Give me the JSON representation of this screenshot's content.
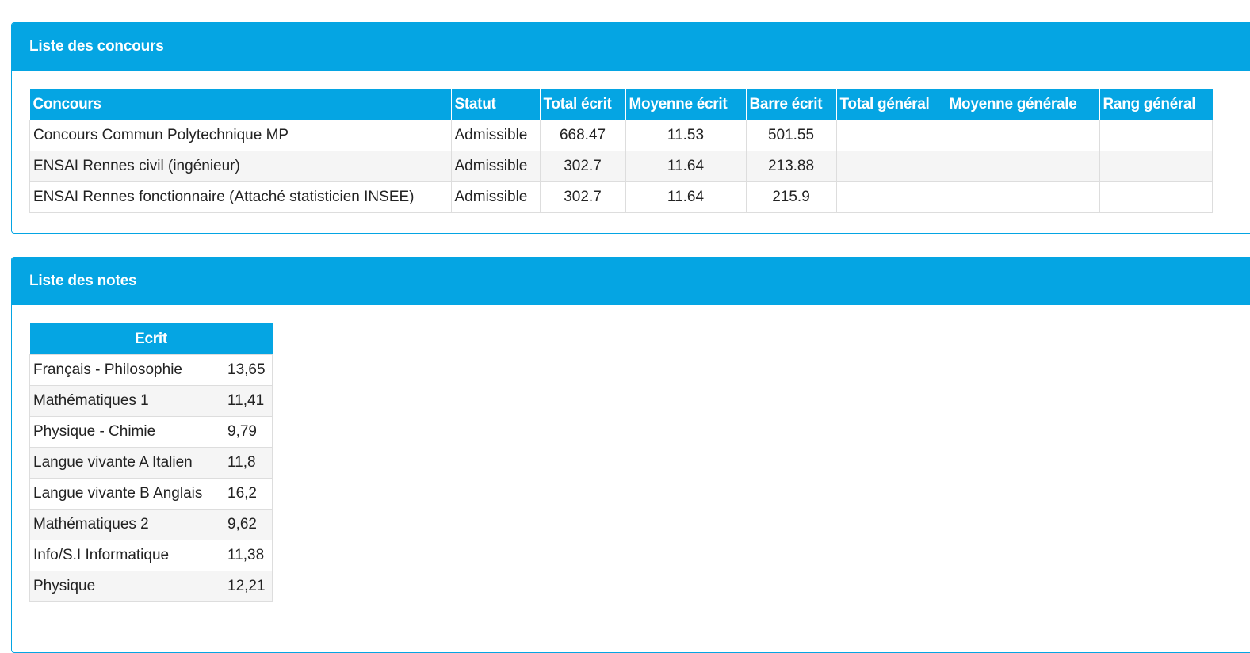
{
  "concours_panel": {
    "title": "Liste des concours",
    "headers": [
      "Concours",
      "Statut",
      "Total écrit",
      "Moyenne écrit",
      "Barre écrit",
      "Total général",
      "Moyenne générale",
      "Rang général"
    ],
    "rows": [
      [
        "Concours Commun Polytechnique MP",
        "Admissible",
        "668.47",
        "11.53",
        "501.55",
        "",
        "",
        ""
      ],
      [
        "ENSAI Rennes civil (ingénieur)",
        "Admissible",
        "302.7",
        "11.64",
        "213.88",
        "",
        "",
        ""
      ],
      [
        "ENSAI Rennes fonctionnaire (Attaché statisticien INSEE)",
        "Admissible",
        "302.7",
        "11.64",
        "215.9",
        "",
        "",
        ""
      ]
    ]
  },
  "notes_panel": {
    "title": "Liste des notes",
    "header": "Ecrit",
    "rows": [
      [
        "Français - Philosophie",
        "13,65"
      ],
      [
        "Mathématiques 1",
        "11,41"
      ],
      [
        "Physique - Chimie",
        "9,79"
      ],
      [
        "Langue vivante A Italien",
        "11,8"
      ],
      [
        "Langue vivante B Anglais",
        "16,2"
      ],
      [
        "Mathématiques 2",
        "9,62"
      ],
      [
        "Info/S.I Informatique",
        "11,38"
      ],
      [
        "Physique",
        "12,21"
      ]
    ]
  },
  "colors": {
    "accent": "#05a5e3",
    "row_alt": "#f5f5f5",
    "border": "#dddddd"
  }
}
